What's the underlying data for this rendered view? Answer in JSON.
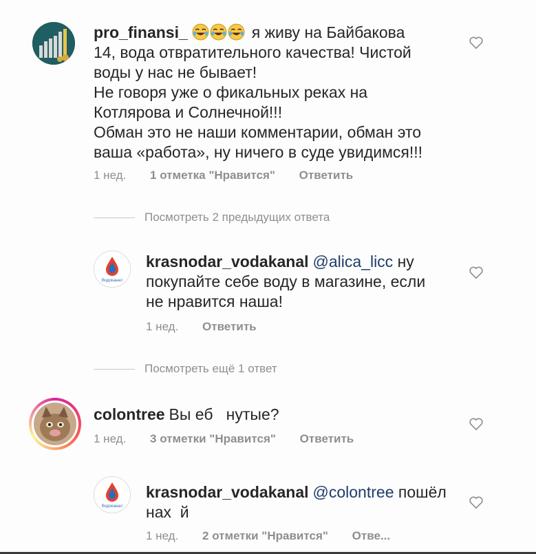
{
  "comments": [
    {
      "username": "pro_finansi_",
      "emoji_count": 3,
      "lines": [
        "я живу на Байбакова",
        "14, вода отвратительного качества! Чистой",
        "воды у нас не бывает!",
        "Не говоря уже о фикальных реках на",
        "Котлярова и Солнечной!!!",
        "Обман это не наши комментарии, обман это",
        "ваша «работа», ну ничего в суде увидимся!!!"
      ],
      "time": "1 нед.",
      "likes": "1 отметка \"Нравится\"",
      "reply": "Ответить"
    },
    {
      "view_more": "Посмотреть 2 предыдущих ответа"
    },
    {
      "username": "krasnodar_vodakanal",
      "mention": "@alica_licc",
      "lines": [
        "ну",
        "покупайте себе воду в магазине, если",
        "не нравится наша!"
      ],
      "time": "1 нед.",
      "reply": "Ответить",
      "avatar_text": "Водоканал"
    },
    {
      "view_more": "Посмотреть ещё 1 ответ"
    },
    {
      "username": "colontree",
      "lines": [
        "Вы еб   нутые?"
      ],
      "time": "1 нед.",
      "likes": "3 отметки \"Нравится\"",
      "reply": "Ответить"
    },
    {
      "username": "krasnodar_vodakanal",
      "mention": "@colontree",
      "lines": [
        "пошёл",
        "нах  й"
      ],
      "time": "1 нед.",
      "likes": "2 отметки \"Нравится\"",
      "reply": "Отве...",
      "avatar_text": "Водоканал"
    }
  ],
  "colors": {
    "text": "#262626",
    "meta": "#8e8e8e",
    "mention": "#1e3d6b"
  }
}
